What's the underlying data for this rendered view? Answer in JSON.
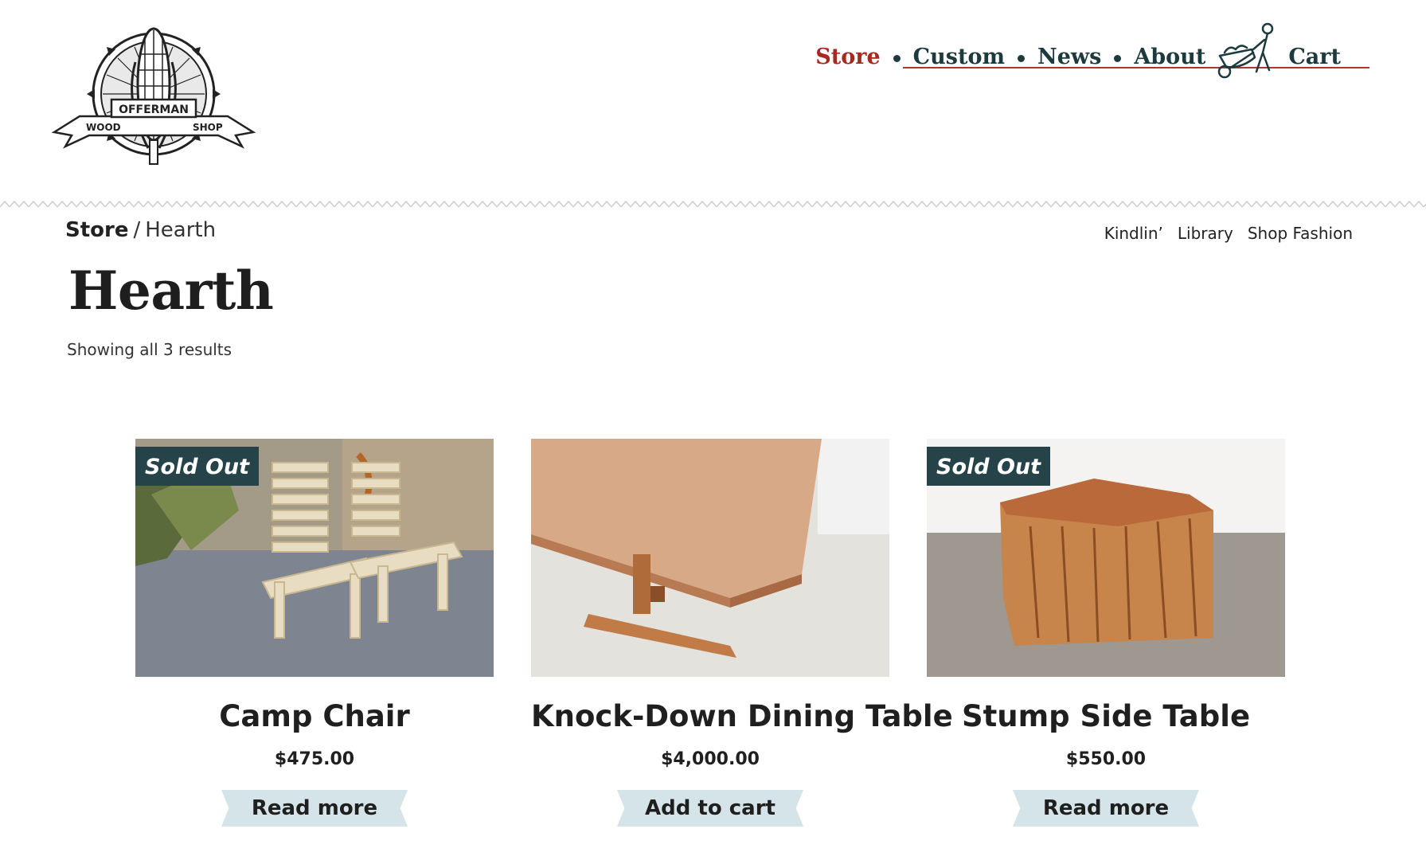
{
  "brand": {
    "logo_text_top": "OFFERMAN",
    "logo_text_left": "WOOD",
    "logo_text_right": "SHOP"
  },
  "nav": {
    "items": [
      {
        "label": "Store",
        "active": true
      },
      {
        "label": "Custom",
        "active": false
      },
      {
        "label": "News",
        "active": false
      },
      {
        "label": "About",
        "active": false
      }
    ],
    "cart_label": "Cart",
    "cart_icon": "wheelbarrow-icon"
  },
  "breadcrumb": {
    "parent": "Store",
    "separator": "/",
    "current": "Hearth"
  },
  "subnav": [
    "Kindlin’",
    "Library",
    "Shop Fashion"
  ],
  "page": {
    "title": "Hearth",
    "results": "Showing all 3 results"
  },
  "products": [
    {
      "name": "Camp Chair",
      "price": "$475.00",
      "badge": "Sold Out",
      "button": "Read more"
    },
    {
      "name": "Knock-Down Dining Table",
      "price": "$4,000.00",
      "badge": "",
      "button": "Add to cart"
    },
    {
      "name": "Stump Side Table",
      "price": "$550.00",
      "badge": "Sold Out",
      "button": "Read more"
    }
  ],
  "colors": {
    "accent_red": "#a8291f",
    "nav_dark": "#1d3a3e",
    "badge_bg": "#26434a",
    "button_bg": "#d5e4e8"
  }
}
